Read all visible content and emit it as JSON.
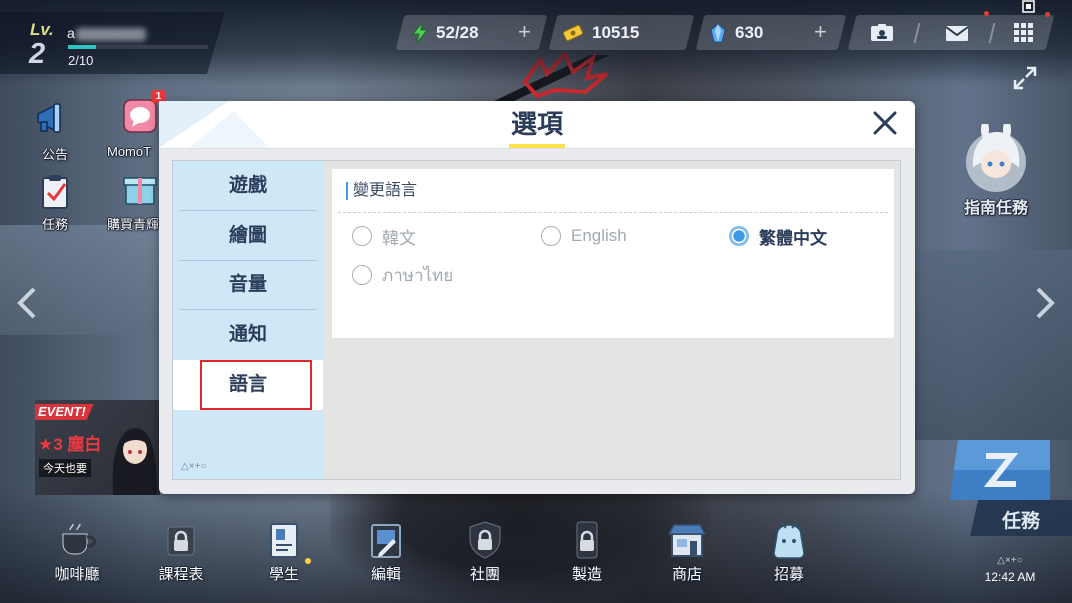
{
  "player": {
    "lv_label": "Lv.",
    "level": "2",
    "name": "a",
    "exp": "2/10"
  },
  "resources": {
    "ap": {
      "icon": "lightning-icon",
      "value": "52/28",
      "plus": "+"
    },
    "credits": {
      "icon": "credit-ticket-icon",
      "value": "10515"
    },
    "gems": {
      "icon": "gem-icon",
      "value": "630",
      "plus": "+"
    }
  },
  "top_icons": {
    "profile": "profile-card-icon",
    "mail": "mail-icon",
    "menu": "menu-grid-icon",
    "capture": "screen-capture-icon"
  },
  "left_menu": [
    {
      "label": "公告",
      "icon": "megaphone-icon"
    },
    {
      "label": "MomoT",
      "icon": "momotalk-icon",
      "badge": "1"
    },
    {
      "label": "任務",
      "icon": "clipboard-check-icon"
    },
    {
      "label": "購買青輝",
      "icon": "gift-box-icon"
    }
  ],
  "event": {
    "tag": "EVENT!",
    "title": "★3 塵白",
    "subtitle": "今天也要"
  },
  "guide": {
    "label": "指南任務",
    "icon": "guide-character-icon"
  },
  "mission_button": {
    "label": "任務",
    "icon": "mission-card-icon"
  },
  "bottom_nav": [
    {
      "label": "咖啡廳",
      "icon": "coffee-cup-icon"
    },
    {
      "label": "課程表",
      "icon": "schedule-lock-icon"
    },
    {
      "label": "學生",
      "icon": "student-card-icon",
      "new": true
    },
    {
      "label": "編輯",
      "icon": "formation-card-icon"
    },
    {
      "label": "社團",
      "icon": "club-shield-icon"
    },
    {
      "label": "製造",
      "icon": "crafting-lock-icon"
    },
    {
      "label": "商店",
      "icon": "shop-icon"
    },
    {
      "label": "招募",
      "icon": "recruit-bag-icon"
    }
  ],
  "status": {
    "buttons_hint": "△×+○",
    "time": "12:42 AM"
  },
  "dialog": {
    "title": "選項",
    "tabs": [
      {
        "label": "遊戲",
        "selected": false
      },
      {
        "label": "繪圖",
        "selected": false
      },
      {
        "label": "音量",
        "selected": false
      },
      {
        "label": "通知",
        "selected": false
      },
      {
        "label": "語言",
        "selected": true
      }
    ],
    "footer_hint": "△×+○",
    "section_title": "變更語言",
    "languages": [
      {
        "label": "韓文",
        "selected": false
      },
      {
        "label": "English",
        "selected": false
      },
      {
        "label": "繁體中文",
        "selected": true
      },
      {
        "label": "ภาษาไทย",
        "selected": false
      }
    ]
  },
  "colors": {
    "accent_blue": "#3d9ae8",
    "title_underline": "#ffe14d",
    "highlight_red": "#e0262a",
    "sidebar_bg": "#cfe8f8",
    "navy_text": "#2b3d5a",
    "badge_red": "#e8363a"
  }
}
